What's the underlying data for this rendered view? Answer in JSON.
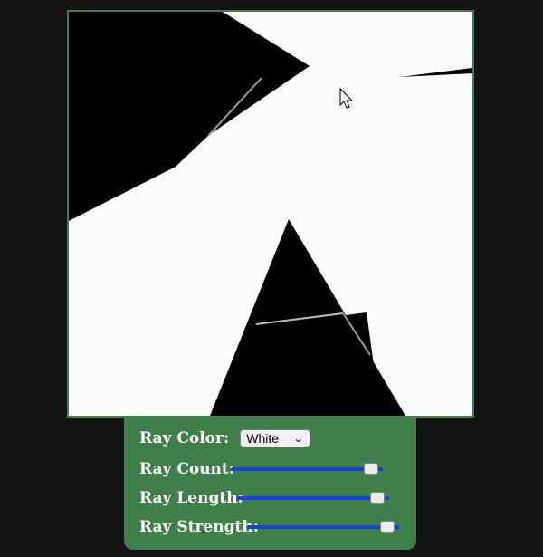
{
  "controls": {
    "ray_color": {
      "label": "Ray Color:",
      "value": "White",
      "options": [
        "White"
      ]
    },
    "ray_count": {
      "label": "Ray Count:",
      "value_fraction": 0.97
    },
    "ray_length": {
      "label": "Ray Length:",
      "value_fraction": 0.97
    },
    "ray_strength": {
      "label": "Ray Strength:",
      "value_fraction": 0.97
    }
  },
  "icons": {
    "dropdown": "chevron-down-icon",
    "cursor": "mouse-pointer-icon"
  },
  "colors": {
    "page_bg": "#141215",
    "panel_bg": "#3f7f4c",
    "canvas_bg": "#fbfbfb",
    "obstacle": "#000000",
    "slider_track": "#1a3fd4"
  }
}
